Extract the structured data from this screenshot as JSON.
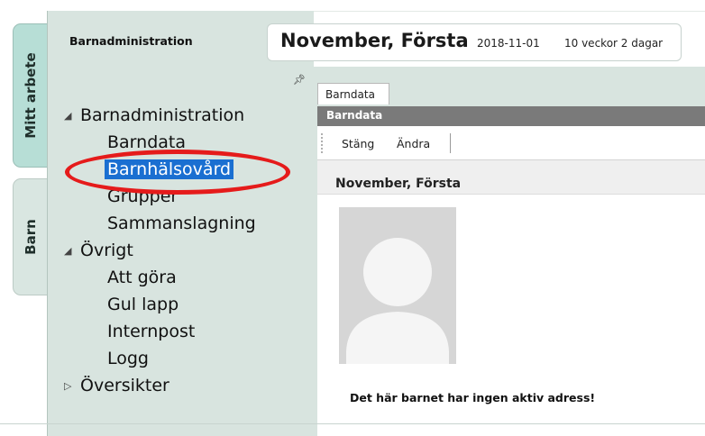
{
  "tabs_vertical": [
    {
      "label": "Mitt arbete"
    },
    {
      "label": "Barn"
    }
  ],
  "nav": {
    "title": "Barnadministration",
    "pin_icon": "pin-icon",
    "tree": [
      {
        "label": "Barnadministration",
        "expanded": true
      },
      {
        "label": "Barndata"
      },
      {
        "label": "Barnhälsovård",
        "selected": true
      },
      {
        "label": "Grupper"
      },
      {
        "label": "Sammanslagning"
      },
      {
        "label": "Övrigt",
        "expanded": true
      },
      {
        "label": "Att göra"
      },
      {
        "label": "Gul lapp"
      },
      {
        "label": "Internpost"
      },
      {
        "label": "Logg"
      },
      {
        "label": "Översikter",
        "expanded": false
      }
    ]
  },
  "header": {
    "name": "November, Första",
    "date": "2018-11-01",
    "age": "10 veckor 2 dagar"
  },
  "document": {
    "tab_label": "Barndata",
    "section_title": "Barndata",
    "toolbar": {
      "close_label": "Stäng",
      "edit_label": "Ändra"
    },
    "name_heading": "November, Första",
    "address_note": "Det här barnet har ingen aktiv adress!"
  },
  "colors": {
    "panel_bg": "#d8e4df",
    "active_vtab": "#b7ded6",
    "selection": "#1a6fd1",
    "section_bar": "#7a7a7a",
    "highlight": "#e51b1b"
  }
}
